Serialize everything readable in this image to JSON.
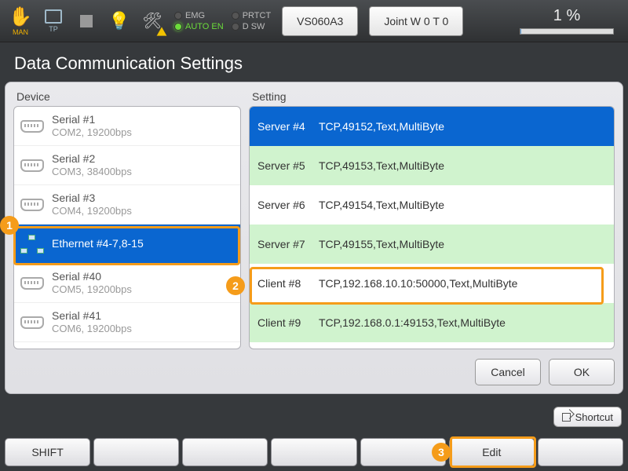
{
  "topbar": {
    "man_label": "MAN",
    "tp_label": "TP",
    "status": {
      "emg": "EMG",
      "autoen": "AUTO EN",
      "prtct": "PRTCT",
      "dsw": "D SW"
    },
    "robot_model": "VS060A3",
    "joint_mode": "Joint  W 0 T 0",
    "speed_pct": "1 %"
  },
  "title": "Data Communication Settings",
  "device_header": "Device",
  "setting_header": "Setting",
  "devices": [
    {
      "name": "Serial #1",
      "sub": "COM2, 19200bps",
      "type": "serial",
      "selected": false
    },
    {
      "name": "Serial #2",
      "sub": "COM3, 38400bps",
      "type": "serial",
      "selected": false
    },
    {
      "name": "Serial #3",
      "sub": "COM4, 19200bps",
      "type": "serial",
      "selected": false
    },
    {
      "name": "Ethernet #4-7,8-15",
      "sub": "",
      "type": "ethernet",
      "selected": true
    },
    {
      "name": "Serial #40",
      "sub": "COM5, 19200bps",
      "type": "serial",
      "selected": false
    },
    {
      "name": "Serial #41",
      "sub": "COM6, 19200bps",
      "type": "serial",
      "selected": false
    }
  ],
  "settings": [
    {
      "name": "Server #4",
      "value": "TCP,49152,Text,MultiByte",
      "style": "sel"
    },
    {
      "name": "Server #5",
      "value": "TCP,49153,Text,MultiByte",
      "style": "alt"
    },
    {
      "name": "Server #6",
      "value": "TCP,49154,Text,MultiByte",
      "style": "plain"
    },
    {
      "name": "Server #7",
      "value": "TCP,49155,Text,MultiByte",
      "style": "alt"
    },
    {
      "name": "Client #8",
      "value": "TCP,192.168.10.10:50000,Text,MultiByte",
      "style": "plain"
    },
    {
      "name": "Client #9",
      "value": "TCP,192.168.0.1:49153,Text,MultiByte",
      "style": "alt"
    }
  ],
  "buttons": {
    "cancel": "Cancel",
    "ok": "OK",
    "shortcut": "Shortcut"
  },
  "fnkeys": [
    "SHIFT",
    "",
    "",
    "",
    "",
    "Edit",
    ""
  ],
  "callouts": [
    "1",
    "2",
    "3"
  ]
}
